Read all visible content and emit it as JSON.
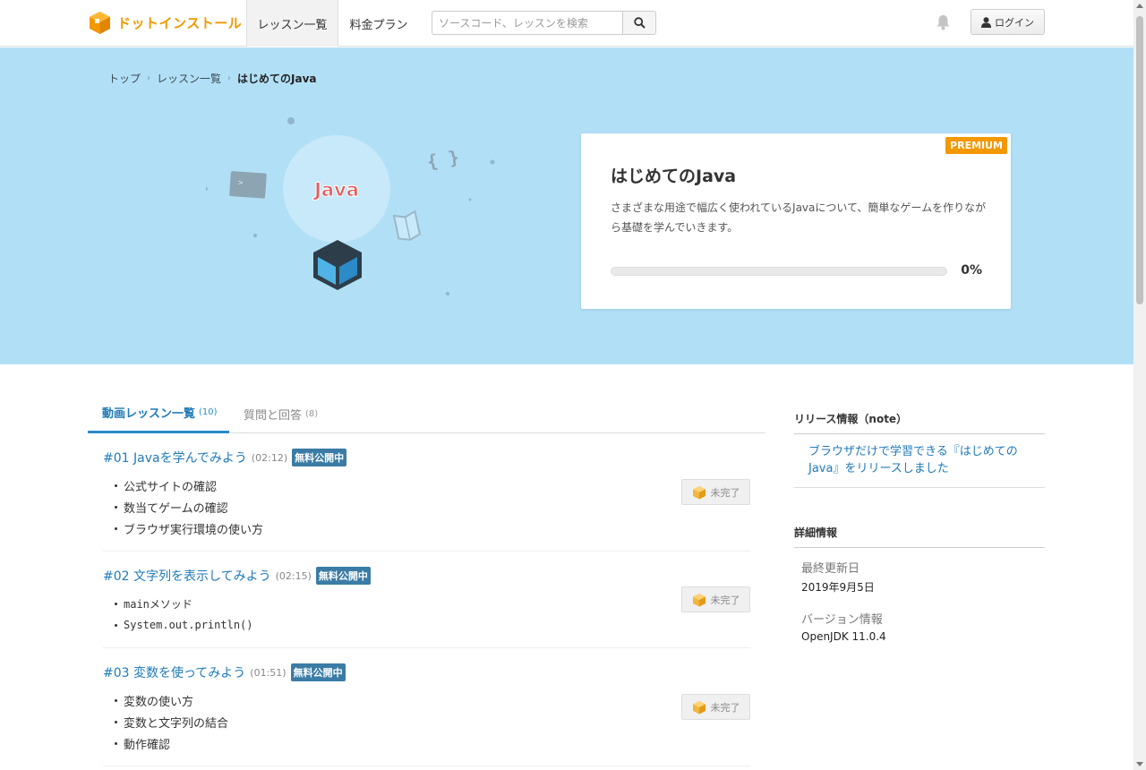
{
  "header": {
    "logo_text": "ドットインストール",
    "nav": [
      {
        "label": "レッスン一覧"
      },
      {
        "label": "料金プラン"
      }
    ],
    "search_placeholder": "ソースコード、レッスンを検索",
    "login_label": "ログイン"
  },
  "breadcrumb": [
    "トップ",
    "レッスン一覧",
    "はじめてのJava"
  ],
  "hero": {
    "art_label": "Java",
    "art_braces": "{ }",
    "card": {
      "badge": "PREMIUM",
      "title": "はじめてのJava",
      "description": "さまざまな用途で幅広く使われているJavaについて、簡単なゲームを作りながら基礎を学んでいきます。",
      "progress_fraction": 0,
      "progress_label": "0%"
    }
  },
  "tabs": [
    {
      "label": "動画レッスン一覧",
      "count": "(10)"
    },
    {
      "label": "質問と回答",
      "count": "(8)"
    }
  ],
  "lessons": [
    {
      "title": "#01 Javaを学んでみよう",
      "duration": "(02:12)",
      "badge": "無料公開中",
      "topics": [
        "公式サイトの確認",
        "数当てゲームの確認",
        "ブラウザ実行環境の使い方"
      ],
      "status": "未完了"
    },
    {
      "title": "#02 文字列を表示してみよう",
      "duration": "(02:15)",
      "badge": "無料公開中",
      "topics": [
        "mainメソッド",
        "System.out.println()"
      ],
      "status": "未完了"
    },
    {
      "title": "#03 変数を使ってみよう",
      "duration": "(01:51)",
      "badge": "無料公開中",
      "topics": [
        "変数の使い方",
        "変数と文字列の結合",
        "動作確認"
      ],
      "status": "未完了"
    }
  ],
  "sidebar": {
    "release_heading": "リリース情報（note）",
    "release_link": "ブラウザだけで学習できる『はじめてのJava』をリリースしました",
    "details_heading": "詳細情報",
    "last_updated_label": "最終更新日",
    "last_updated_value": "2019年9月5日",
    "version_label": "バージョン情報",
    "version_value": "OpenJDK 11.0.4"
  },
  "colors": {
    "brand": "#f39800",
    "hero_bg": "#b1e0f6",
    "link": "#1f7ab8",
    "free_badge": "#3a7ca5"
  },
  "icons": [
    "logo-box-icon",
    "search-icon",
    "bell-icon",
    "user-icon",
    "lesson-box-icon"
  ]
}
